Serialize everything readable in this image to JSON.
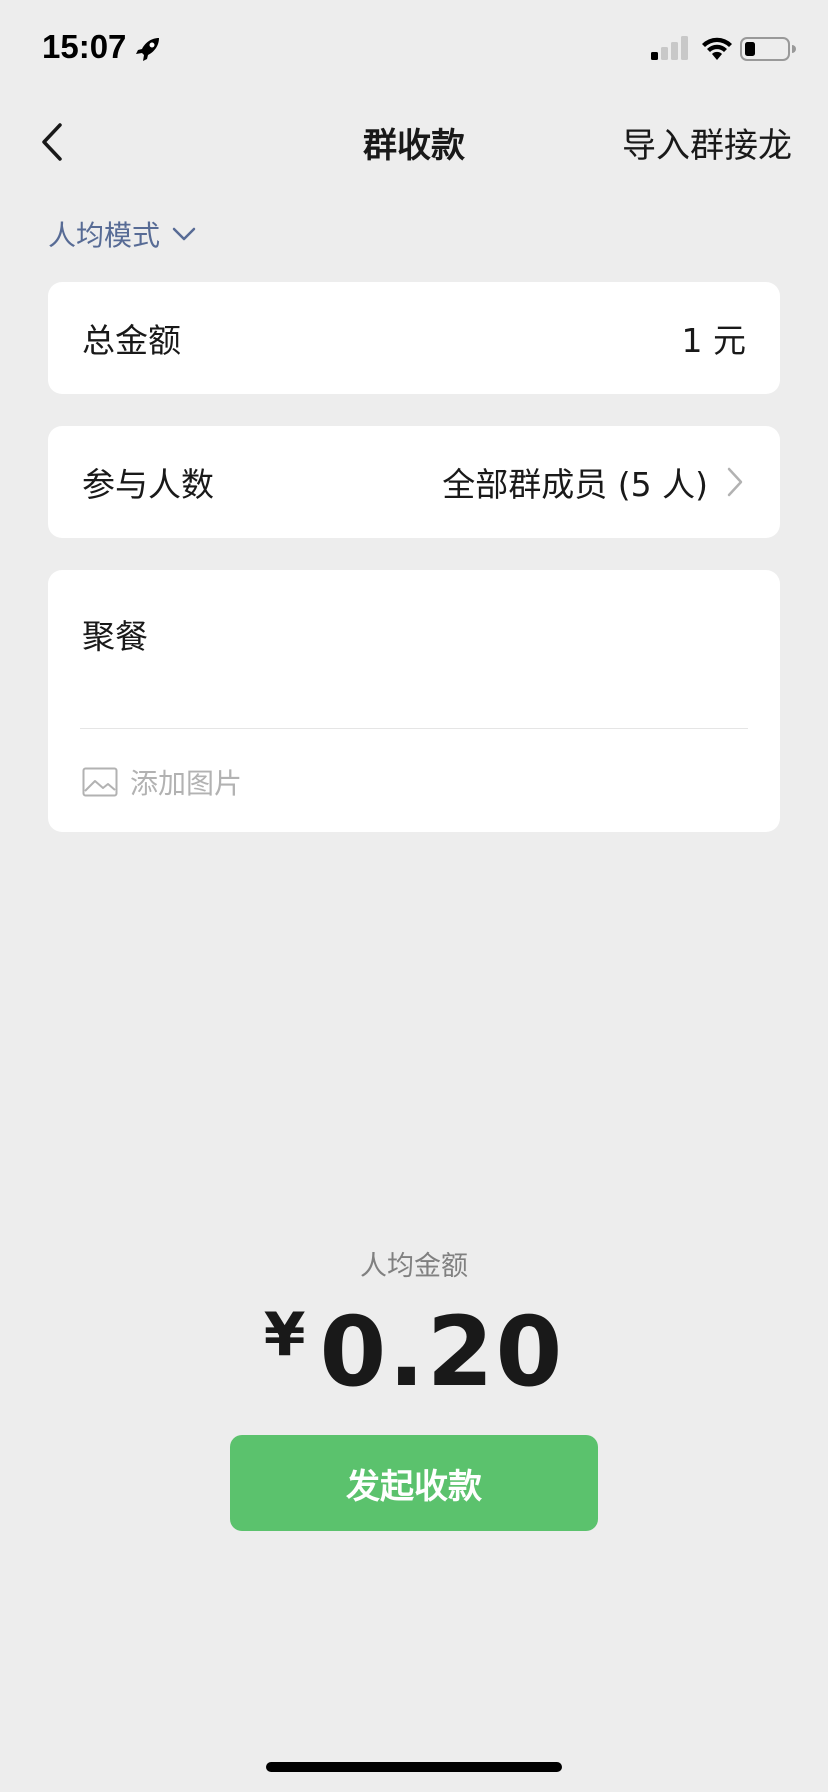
{
  "status_bar": {
    "time": "15:07",
    "icons": [
      "rocket-icon",
      "signal-icon",
      "wifi-icon",
      "battery-icon"
    ]
  },
  "nav": {
    "back_icon": "chevron-left-icon",
    "title": "群收款",
    "action_label": "导入群接龙"
  },
  "mode": {
    "label": "人均模式",
    "icon": "chevron-down-icon"
  },
  "total": {
    "label": "总金额",
    "value": "1 元"
  },
  "participants": {
    "label": "参与人数",
    "value": "全部群成员 (5 人)",
    "icon": "chevron-right-icon"
  },
  "note": {
    "text": "聚餐",
    "add_image_label": "添加图片",
    "add_image_icon": "image-icon"
  },
  "summary": {
    "label": "人均金额",
    "currency": "¥",
    "amount": "0.20"
  },
  "submit": {
    "label": "发起收款"
  },
  "colors": {
    "background": "#ededed",
    "link": "#576b95",
    "primary": "#5bc26d",
    "card": "#ffffff"
  }
}
